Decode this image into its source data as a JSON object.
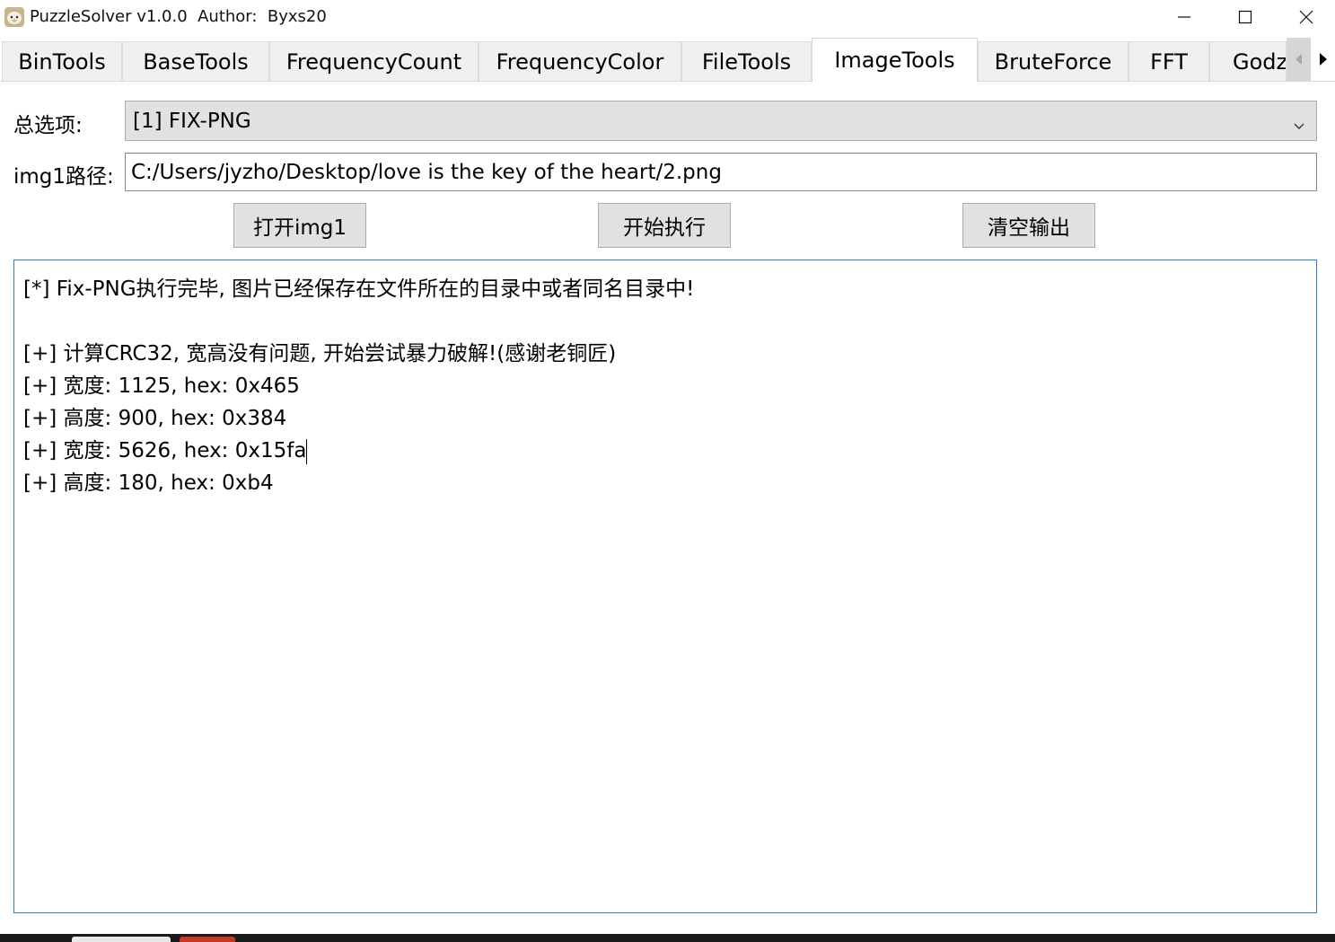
{
  "window": {
    "title": "PuzzleSolver v1.0.0  Author:  Byxs20",
    "icon": "sheep-icon"
  },
  "tabs": [
    {
      "label": "BinTools",
      "active": false
    },
    {
      "label": "BaseTools",
      "active": false
    },
    {
      "label": "FrequencyCount",
      "active": false
    },
    {
      "label": "FrequencyColor",
      "active": false
    },
    {
      "label": "FileTools",
      "active": false
    },
    {
      "label": "ImageTools",
      "active": true
    },
    {
      "label": "BruteForce",
      "active": false
    },
    {
      "label": "FFT",
      "active": false
    },
    {
      "label": "Godzi",
      "active": false
    }
  ],
  "form": {
    "option_label": "总选项:",
    "option_value": "[1] FIX-PNG",
    "path_label": "img1路径:",
    "path_value": "C:/Users/jyzho/Desktop/love is the key of the heart/2.png"
  },
  "buttons": {
    "open_img1": "打开img1",
    "execute": "开始执行",
    "clear_output": "清空输出"
  },
  "output": {
    "lines": [
      "[*] Fix-PNG执行完毕, 图片已经保存在文件所在的目录中或者同名目录中!",
      "",
      "[+] 计算CRC32, 宽高没有问题, 开始尝试暴力破解!(感谢老铜匠)",
      "[+] 宽度: 1125, hex: 0x465",
      "[+] 高度: 900, hex: 0x384",
      "[+] 宽度: 5626, hex: 0x15fa",
      "[+] 高度: 180, hex: 0xb4"
    ]
  },
  "colors": {
    "output_border": "#2d7dbf",
    "button_bg": "#e1e1e1",
    "tab_bg": "#f0f0f0"
  }
}
